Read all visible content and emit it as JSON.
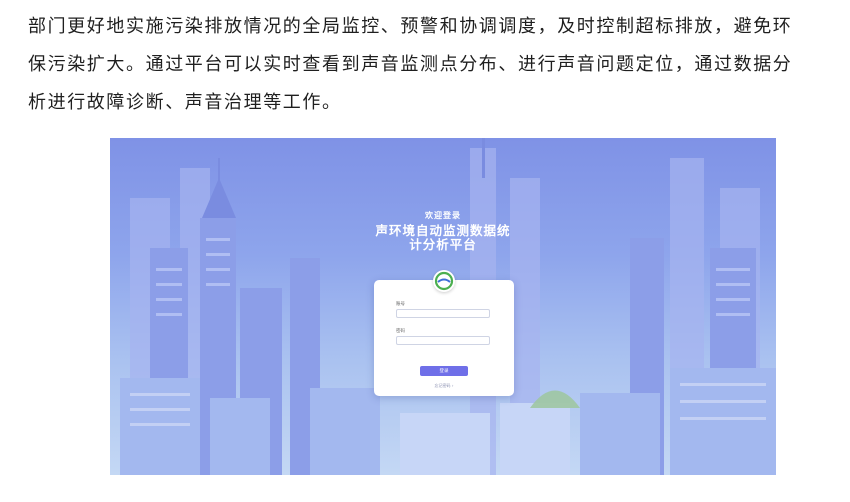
{
  "document": {
    "lines": [
      "部门更好地实施污染排放情况的全局监控、预警和协调调度，及时控制超标排放，避免环",
      "保污染扩大。通过平台可以实时查看到声音监测点分布、进行声音问题定位，通过数据分",
      "析进行故障诊断、声音治理等工作。"
    ]
  },
  "screenshot": {
    "welcome": "欢迎登录",
    "title_line1": "声环境自动监测数据统",
    "title_line2": "计分析平台",
    "login_form": {
      "account_label": "账号",
      "account_value": "",
      "password_label": "密码",
      "password_value": "",
      "login_button": "登录",
      "forgot_link": "忘记密码"
    }
  },
  "colors": {
    "sky_top": "#7f92e6",
    "sky_bottom": "#c4d8f4",
    "button": "#6f6fe8",
    "logo_green": "#4caf50",
    "logo_blue": "#3f6fd8"
  }
}
